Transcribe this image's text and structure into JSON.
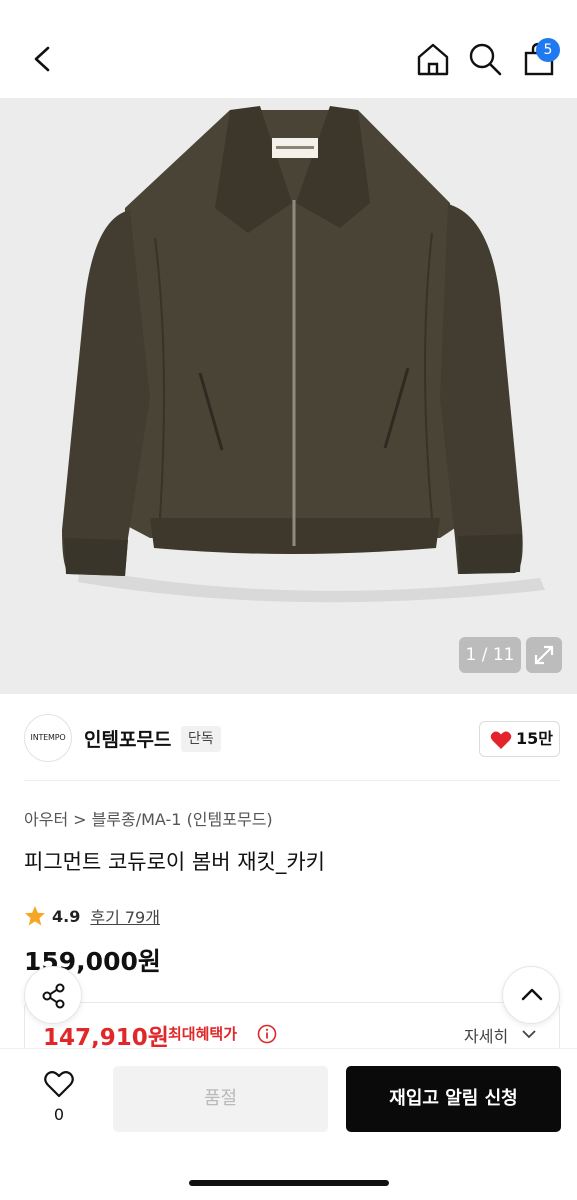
{
  "header": {
    "cart_count": "5"
  },
  "icons": {
    "back": "chevron-left-icon",
    "home": "home-icon",
    "search": "search-icon",
    "cart": "shopping-bag-icon",
    "expand": "expand-icon",
    "like": "heart-icon",
    "star": "star-icon",
    "info": "info-icon",
    "share": "share-icon",
    "scroll_top": "chevron-up-icon",
    "wish": "heart-outline-icon"
  },
  "gallery": {
    "counter": "1 / 11",
    "hero_bg": "#ececec"
  },
  "brand": {
    "logo_text": "INTEMPO",
    "name": "인템포무드",
    "tag": "단독",
    "likes": "15만"
  },
  "breadcrumb": {
    "level1": "아우터",
    "separator": ">",
    "level2": "블루종/MA-1 (인템포무드)"
  },
  "product": {
    "title": "피그먼트 코듀로이 봄버 재킷_카키",
    "rating": "4.9",
    "reviews": "후기 79개",
    "price": "159,000원",
    "sale_price": "147,910원",
    "sale_label": "최대혜택가",
    "detail_link": "자세히"
  },
  "actions": {
    "wish_count": "0",
    "soldout_label": "품절",
    "restock_label": "재입고 알림 신청"
  },
  "colors": {
    "accent_blue": "#1f7af2",
    "sale_red": "#e0282a",
    "like_red": "#e3242b",
    "star_orange": "#f5a623",
    "primary_button": "#0a0a0a"
  }
}
